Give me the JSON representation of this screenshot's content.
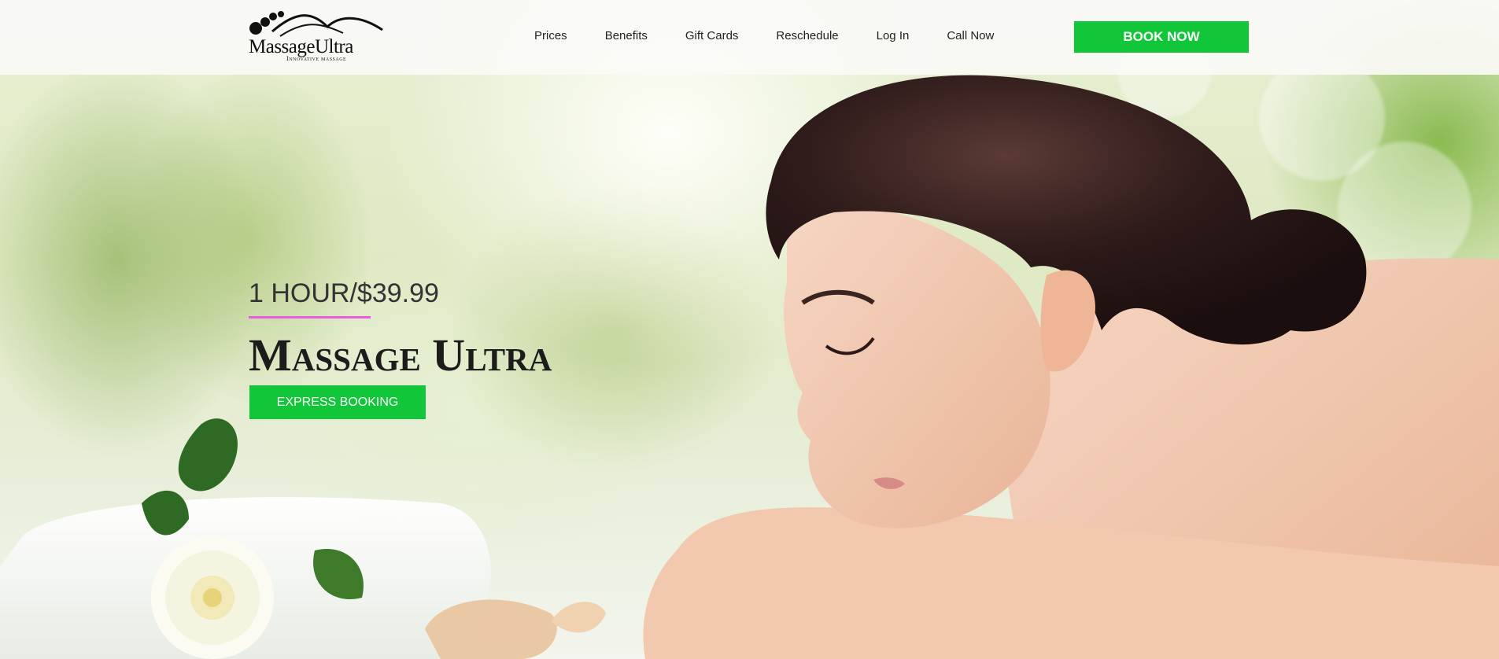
{
  "header": {
    "logo": {
      "name": "MassageUltra",
      "tagline": "Innovative massage"
    },
    "nav": [
      {
        "label": "Prices"
      },
      {
        "label": "Benefits"
      },
      {
        "label": "Gift Cards"
      },
      {
        "label": "Reschedule"
      },
      {
        "label": "Log In"
      },
      {
        "label": "Call Now"
      }
    ],
    "book_now_label": "BOOK NOW"
  },
  "hero": {
    "price": "1 HOUR/$39.99",
    "title": "Massage Ultra",
    "express_booking_label": "EXPRESS BOOKING"
  },
  "colors": {
    "accent_green": "#12c63a",
    "underline_pink": "#e85ce0"
  }
}
